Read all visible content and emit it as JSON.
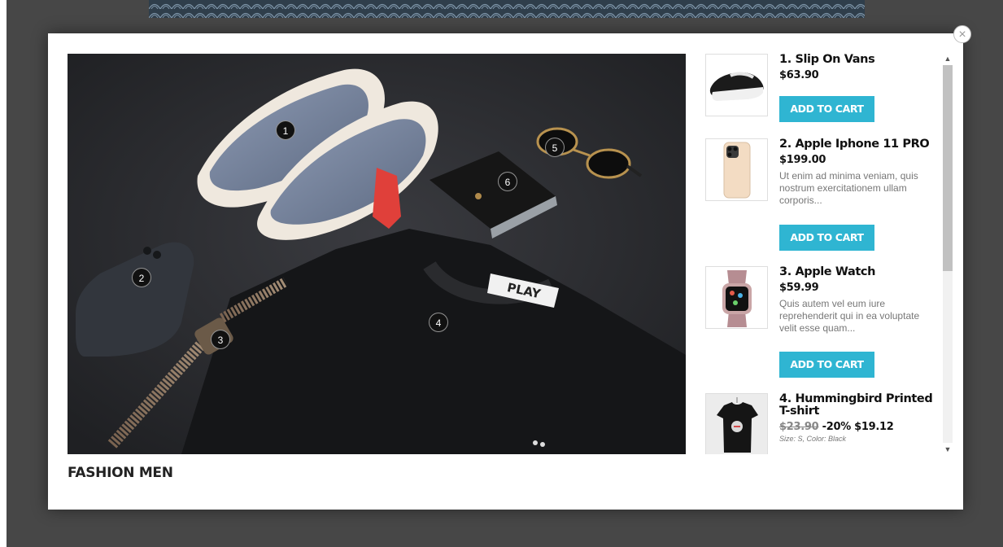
{
  "close_symbol": "×",
  "caption": "FASHION MEN",
  "hotspots": [
    "1",
    "2",
    "3",
    "4",
    "5",
    "6"
  ],
  "products": [
    {
      "name": "1. Slip On Vans",
      "price": "$63.90",
      "button": "ADD TO CART"
    },
    {
      "name": "2. Apple Iphone 11 PRO",
      "price": "$199.00",
      "description": "Ut enim ad minima veniam, quis nostrum exercitationem ullam corporis...",
      "button": "ADD TO CART"
    },
    {
      "name": "3. Apple Watch",
      "price": "$59.99",
      "description": "Quis autem vel eum iure reprehenderit qui in ea voluptate velit esse quam...",
      "button": "ADD TO CART"
    },
    {
      "name": "4. Hummingbird Printed T-shirt",
      "old_price": "$23.90",
      "discount": "-20%",
      "price": "$19.12",
      "attributes": "Size: S, Color: Black"
    }
  ],
  "scroll_up_icon": "chevron-up-icon",
  "scroll_down_icon": "chevron-down-icon",
  "colors": {
    "backdrop": "#474747",
    "button": "#2fb5d2",
    "pattern": "#33495a"
  }
}
